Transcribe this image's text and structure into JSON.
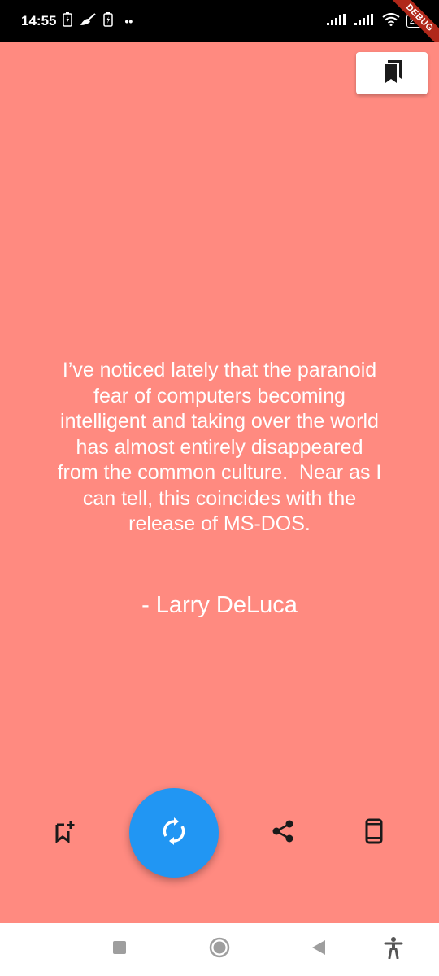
{
  "status_bar": {
    "time": "14:55",
    "battery": "27",
    "debug_label": "DEBUG"
  },
  "quote": {
    "text": "I’ve noticed lately that the paranoid\nfear of computers becoming\nintelligent and taking over the world\nhas almost entirely disappeared\nfrom the common culture.  Near as I\ncan tell, this coincides with the\nrelease of MS-DOS.",
    "author": "- Larry DeLuca"
  },
  "colors": {
    "background": "#ff8a80",
    "fab": "#2196f3",
    "icon": "#1a1a1a"
  },
  "icons": {
    "saved": "bookmarks-icon",
    "add_bookmark": "bookmark-add-icon",
    "refresh": "refresh-icon",
    "share": "share-icon",
    "device": "phone-icon"
  }
}
